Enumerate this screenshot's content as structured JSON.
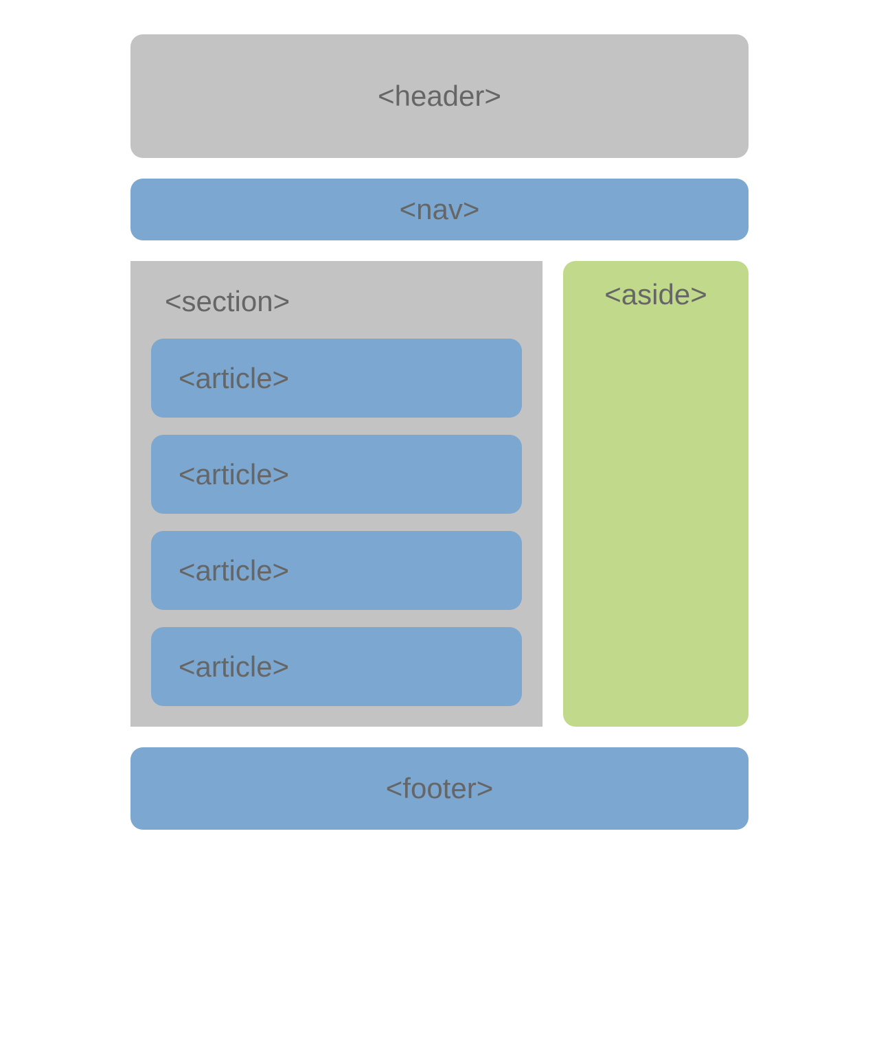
{
  "diagram": {
    "header": "<header>",
    "nav": "<nav>",
    "section": "<section>",
    "articles": [
      "<article>",
      "<article>",
      "<article>",
      "<article>"
    ],
    "aside": "<aside>",
    "footer": "<footer>"
  },
  "colors": {
    "gray": "#c3c3c3",
    "blue": "#7ba7d0",
    "green": "#c0d98a",
    "text": "#666666"
  }
}
